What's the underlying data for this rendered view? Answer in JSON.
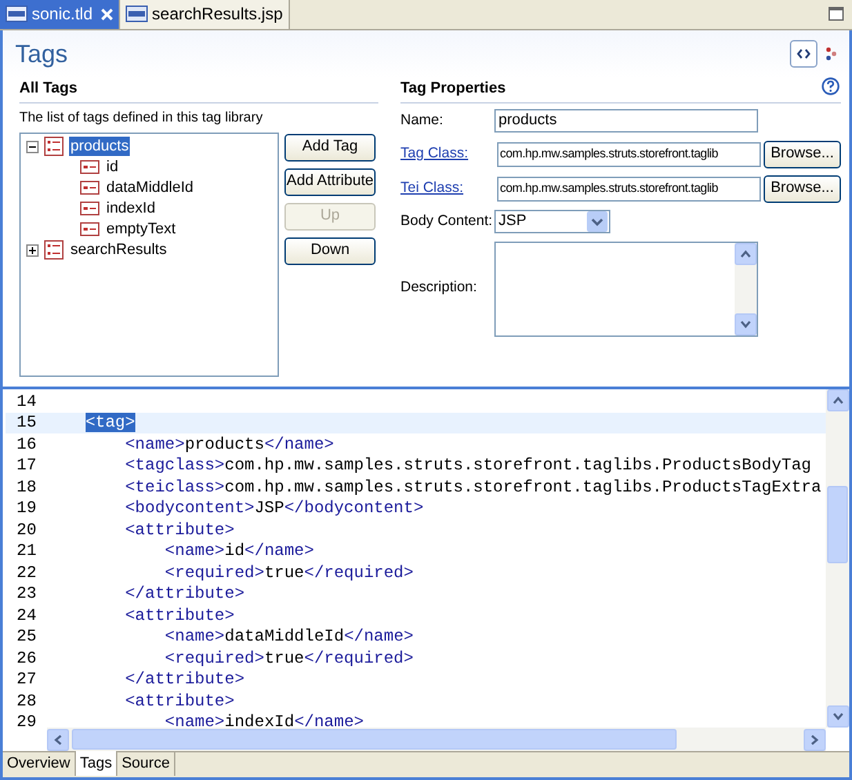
{
  "editor_tabs": [
    {
      "label": "sonic.tld",
      "selected": true,
      "closable": true
    },
    {
      "label": "searchResults.jsp",
      "selected": false,
      "closable": false
    }
  ],
  "page_title": "Tags",
  "all_tags": {
    "title": "All Tags",
    "description": "The list of tags defined in this tag library",
    "tree": [
      {
        "label": "products",
        "kind": "tag",
        "expanded": true,
        "selected": true,
        "children": [
          {
            "label": "id",
            "kind": "attribute",
            "selected": false
          },
          {
            "label": "dataMiddleId",
            "kind": "attribute",
            "selected": false
          },
          {
            "label": "indexId",
            "kind": "attribute",
            "selected": false
          },
          {
            "label": "emptyText",
            "kind": "attribute",
            "selected": false
          }
        ]
      },
      {
        "label": "searchResults",
        "kind": "tag",
        "expanded": false,
        "selected": false
      }
    ],
    "buttons": [
      {
        "label": "Add Tag",
        "disabled": false
      },
      {
        "label": "Add Attribute",
        "disabled": false
      },
      {
        "label": "Up",
        "disabled": true
      },
      {
        "label": "Down",
        "disabled": false
      }
    ]
  },
  "tag_properties": {
    "title": "Tag Properties",
    "fields": [
      {
        "kind": "text",
        "label": "Name:",
        "link": false,
        "value": "products"
      },
      {
        "kind": "browse",
        "label": "Tag Class:",
        "link": true,
        "value": "com.hp.mw.samples.struts.storefront.taglib",
        "button": "Browse..."
      },
      {
        "kind": "browse",
        "label": "Tei Class:",
        "link": true,
        "value": "com.hp.mw.samples.struts.storefront.taglib",
        "button": "Browse..."
      },
      {
        "kind": "select",
        "label": "Body Content:",
        "link": false,
        "value": "JSP"
      },
      {
        "kind": "textarea",
        "label": "Description:",
        "link": false
      }
    ]
  },
  "source": {
    "lines": [
      {
        "number": "14",
        "current": false
      },
      {
        "number": "15",
        "text": "    <tag>",
        "current": true
      },
      {
        "number": "16",
        "text": "        <name>products</name>",
        "current": false
      },
      {
        "number": "17",
        "text": "        <tagclass>com.hp.mw.samples.struts.storefront.taglibs.ProductsBodyTag",
        "current": false
      },
      {
        "number": "18",
        "text": "        <teiclass>com.hp.mw.samples.struts.storefront.taglibs.ProductsTagExtra",
        "current": false
      },
      {
        "number": "19",
        "text": "        <bodycontent>JSP</bodycontent>",
        "current": false
      },
      {
        "number": "20",
        "text": "        <attribute>",
        "current": false
      },
      {
        "number": "21",
        "text": "            <name>id</name>",
        "current": false
      },
      {
        "number": "22",
        "text": "            <required>true</required>",
        "current": false
      },
      {
        "number": "23",
        "text": "        </attribute>",
        "current": false
      },
      {
        "number": "24",
        "text": "        <attribute>",
        "current": false
      },
      {
        "number": "25",
        "text": "            <name>dataMiddleId</name>",
        "current": false
      },
      {
        "number": "26",
        "text": "            <required>true</required>",
        "current": false
      },
      {
        "number": "27",
        "text": "        </attribute>",
        "current": false
      },
      {
        "number": "28",
        "text": "        <attribute>",
        "current": false
      },
      {
        "number": "29",
        "text": "            <name>indexId</name>",
        "current": false
      }
    ]
  },
  "page_tabs": [
    {
      "label": "Overview",
      "selected": false
    },
    {
      "label": "Tags",
      "selected": true
    },
    {
      "label": "Source",
      "selected": false
    }
  ]
}
